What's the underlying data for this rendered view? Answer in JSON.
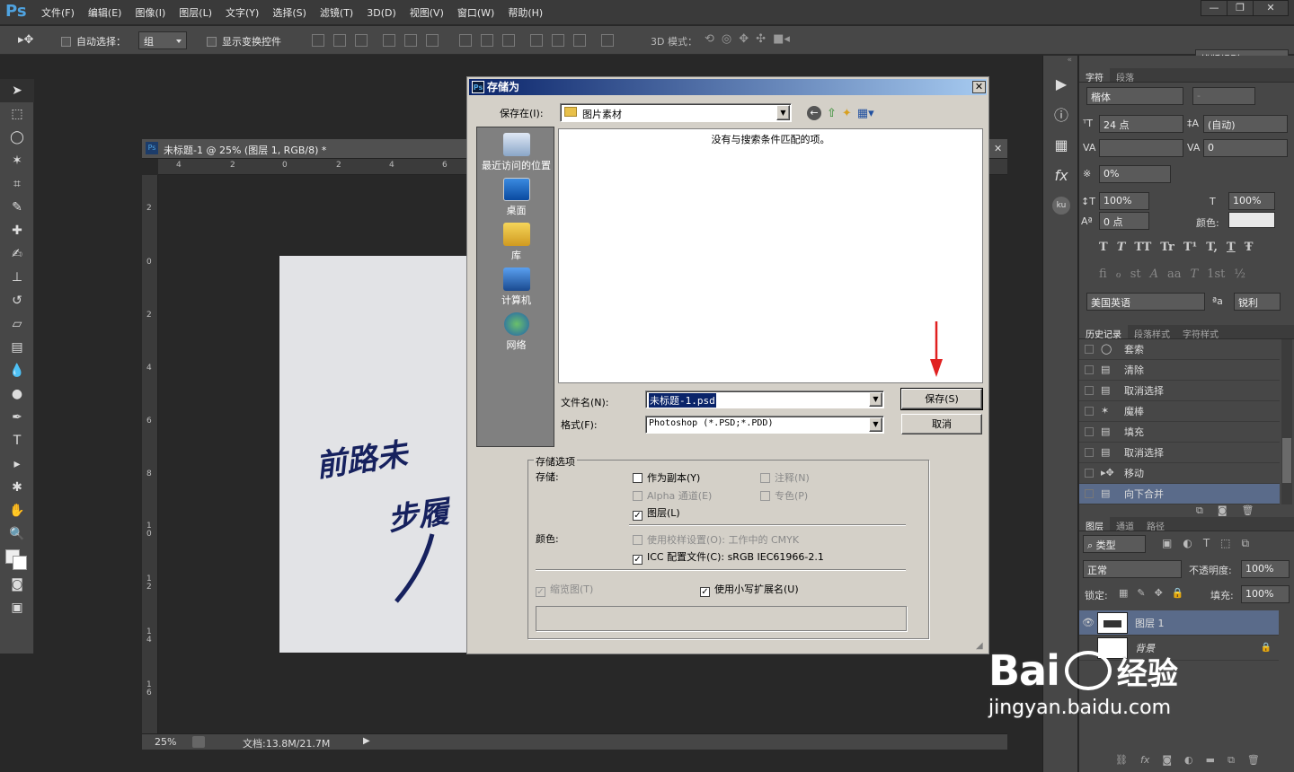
{
  "app": {
    "logo": "Ps",
    "menus": [
      "文件(F)",
      "编辑(E)",
      "图像(I)",
      "图层(L)",
      "文字(Y)",
      "选择(S)",
      "滤镜(T)",
      "3D(D)",
      "视图(V)",
      "窗口(W)",
      "帮助(H)"
    ],
    "window_buttons": {
      "minimize": "—",
      "restore": "❐",
      "close": "✕"
    }
  },
  "options_bar": {
    "auto_select_label": "自动选择：",
    "auto_select_value": "组",
    "show_transform_label": "显示变换控件",
    "mode_3d_label": "3D 模式：",
    "workspace": "排版规则"
  },
  "document": {
    "title": "未标题-1 @ 25% (图层 1, RGB/8) *",
    "ruler_h": [
      "4",
      "2",
      "0",
      "2",
      "4",
      "6"
    ],
    "ruler_v": [
      "2",
      "0",
      "2",
      "4",
      "6",
      "8",
      "1\n0",
      "1\n2",
      "1\n4",
      "1\n6"
    ],
    "zoom": "25%",
    "doc_size": "文档:13.8M/21.7M",
    "calligraphy_line1": "前路未",
    "calligraphy_line2": "步履"
  },
  "save_dialog": {
    "title": "存储为",
    "save_in_label": "保存在(I):",
    "save_in_value": "图片素材",
    "empty_message": "没有与搜索条件匹配的项。",
    "places": [
      {
        "label": "最近访问的位置",
        "icon": "recent-icon"
      },
      {
        "label": "桌面",
        "icon": "desktop-icon"
      },
      {
        "label": "库",
        "icon": "library-icon"
      },
      {
        "label": "计算机",
        "icon": "computer-icon"
      },
      {
        "label": "网络",
        "icon": "network-icon"
      }
    ],
    "filename_label": "文件名(N):",
    "filename_value": "未标题-1.psd",
    "format_label": "格式(F):",
    "format_value": "Photoshop (*.PSD;*.PDD)",
    "save_button": "保存(S)",
    "cancel_button": "取消",
    "options_group": "存储选项",
    "store_label": "存储:",
    "as_copy": "作为副本(Y)",
    "annotations": "注释(N)",
    "alpha_channels": "Alpha 通道(E)",
    "spot_colors": "专色(P)",
    "layers": "图层(L)",
    "color_label": "颜色:",
    "use_proof": "使用校样设置(O): 工作中的 CMYK",
    "icc_profile": "ICC 配置文件(C): sRGB IEC61966-2.1",
    "thumbnail": "缩览图(T)",
    "lowercase_ext": "使用小写扩展名(U)"
  },
  "character_panel": {
    "tabs": [
      "字符",
      "段落"
    ],
    "font_family": "楷体",
    "font_style": "-",
    "font_size": "24 点",
    "leading": "(自动)",
    "kerning": "",
    "tracking": "0",
    "scale_percent": "0%",
    "vertical_scale": "100%",
    "horizontal_scale": "100%",
    "baseline_shift": "0 点",
    "color_label": "颜色:",
    "type_styles": [
      "T",
      "T",
      "TT",
      "Tr",
      "T¹",
      "T,",
      "T",
      "Ŧ"
    ],
    "opentype_styles": [
      "ﬁ",
      "ℴ",
      "st",
      "A",
      "aa",
      "T",
      "1st",
      "½"
    ],
    "language": "美国英语",
    "aa_label": "ªa",
    "antialias": "锐利"
  },
  "history_panel": {
    "tabs": [
      "历史记录",
      "段落样式",
      "字符样式"
    ],
    "items": [
      {
        "label": "套索",
        "icon": "lasso-icon"
      },
      {
        "label": "清除",
        "icon": "document-icon"
      },
      {
        "label": "取消选择",
        "icon": "document-icon"
      },
      {
        "label": "魔棒",
        "icon": "magic-wand-icon"
      },
      {
        "label": "填充",
        "icon": "fill-icon"
      },
      {
        "label": "取消选择",
        "icon": "document-icon"
      },
      {
        "label": "移动",
        "icon": "move-icon"
      },
      {
        "label": "向下合并",
        "icon": "document-icon"
      }
    ]
  },
  "layers_panel": {
    "tabs": [
      "图层",
      "通道",
      "路径"
    ],
    "filter_type": "类型",
    "blend_mode": "正常",
    "opacity_label": "不透明度:",
    "opacity": "100%",
    "lock_label": "锁定:",
    "fill_label": "填充:",
    "fill": "100%",
    "layers": [
      {
        "name": "图层 1",
        "visible": true
      },
      {
        "name": "背景",
        "visible": false
      }
    ]
  },
  "watermark": {
    "brand": "Bai",
    "sub": "经验",
    "url": "jingyan.baidu.com"
  },
  "colors": {
    "titlebar_start": "#0a246a",
    "titlebar_end": "#a6caf0",
    "accent": "#4fa3e0",
    "arrow": "#e02020"
  }
}
